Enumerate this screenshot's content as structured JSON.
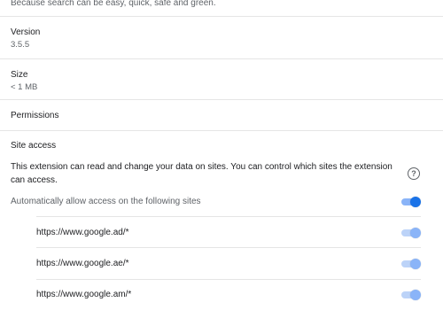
{
  "description": "Because search can be easy, quick, safe and green.",
  "version": {
    "label": "Version",
    "value": "3.5.5"
  },
  "size": {
    "label": "Size",
    "value": "< 1 MB"
  },
  "permissions": {
    "label": "Permissions"
  },
  "site_access": {
    "label": "Site access",
    "info": "This extension can read and change your data on sites. You can control which sites the extension can access.",
    "help_icon": "help-circle-icon",
    "auto_allow_label": "Automatically allow access on the following sites",
    "auto_allow_on": true,
    "sites": [
      {
        "url": "https://www.google.ad/*",
        "enabled": true
      },
      {
        "url": "https://www.google.ae/*",
        "enabled": true
      },
      {
        "url": "https://www.google.am/*",
        "enabled": true
      }
    ]
  },
  "colors": {
    "accent": "#1a73e8",
    "accent_light": "#8ab4f8",
    "divider": "#e5e5e5"
  }
}
